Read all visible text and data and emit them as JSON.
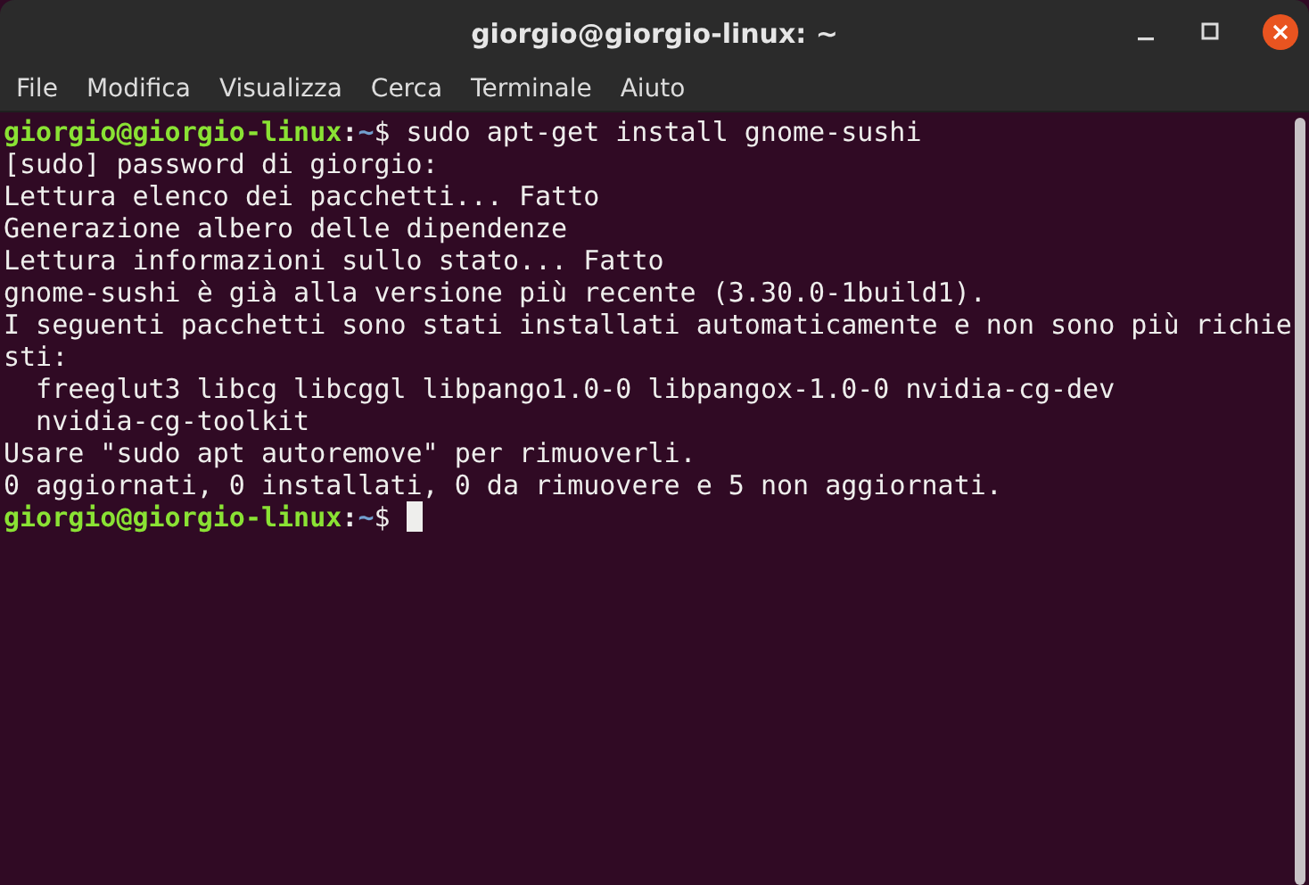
{
  "window": {
    "title": "giorgio@giorgio-linux: ~"
  },
  "menu": [
    "File",
    "Modifica",
    "Visualizza",
    "Cerca",
    "Terminale",
    "Aiuto"
  ],
  "terminal": {
    "lines": [
      {
        "kind": "prompt",
        "user_host": "giorgio@giorgio-linux",
        "separator": ":",
        "path": "~",
        "symbol": "$",
        "command": "sudo apt-get install gnome-sushi"
      },
      {
        "kind": "output",
        "text": "[sudo] password di giorgio:"
      },
      {
        "kind": "output",
        "text": "Lettura elenco dei pacchetti... Fatto"
      },
      {
        "kind": "output",
        "text": "Generazione albero delle dipendenze"
      },
      {
        "kind": "output",
        "text": "Lettura informazioni sullo stato... Fatto"
      },
      {
        "kind": "output",
        "text": "gnome-sushi è già alla versione più recente (3.30.0-1build1)."
      },
      {
        "kind": "output",
        "text": "I seguenti pacchetti sono stati installati automaticamente e non sono più richie"
      },
      {
        "kind": "output",
        "text": "sti:"
      },
      {
        "kind": "output",
        "text": "  freeglut3 libcg libcggl libpango1.0-0 libpangox-1.0-0 nvidia-cg-dev"
      },
      {
        "kind": "output",
        "text": "  nvidia-cg-toolkit"
      },
      {
        "kind": "output",
        "text": "Usare \"sudo apt autoremove\" per rimuoverli."
      },
      {
        "kind": "output",
        "text": "0 aggiornati, 0 installati, 0 da rimuovere e 5 non aggiornati."
      },
      {
        "kind": "prompt",
        "user_host": "giorgio@giorgio-linux",
        "separator": ":",
        "path": "~",
        "symbol": "$",
        "cursor": true
      }
    ]
  }
}
